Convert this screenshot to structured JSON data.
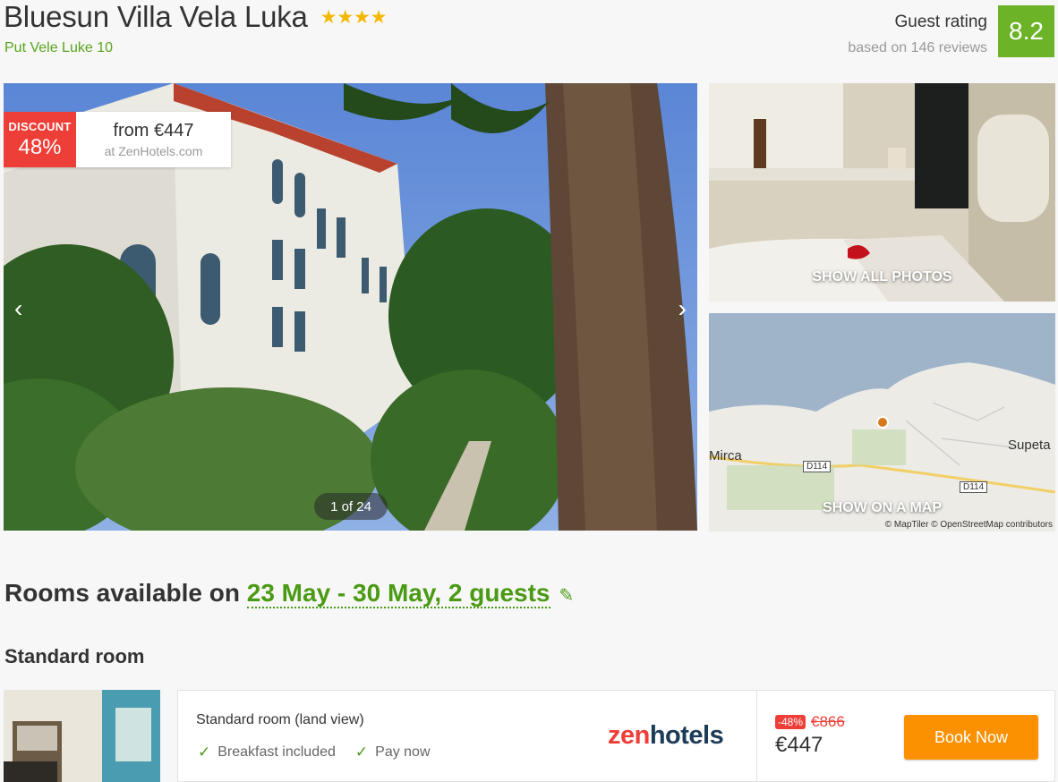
{
  "hotel": {
    "name": "Bluesun Villa Vela Luka",
    "stars": "★★★★",
    "address": "Put Vele Luke 10"
  },
  "rating": {
    "label": "Guest rating",
    "reviews": "based on 146 reviews",
    "score": "8.2"
  },
  "gallery": {
    "discount_label": "DISCOUNT",
    "discount_value": "48%",
    "from_price": "from €447",
    "source": "at ZenHotels.com",
    "counter": "1 of 24",
    "prev_icon": "‹",
    "next_icon": "›",
    "show_photos": "SHOW ALL PHOTOS"
  },
  "map": {
    "show_map": "SHOW ON A MAP",
    "credit": "© MapTiler © OpenStreetMap contributors",
    "city_left": "Mirca",
    "city_right": "Supeta",
    "road_1": "D114",
    "road_2": "D114"
  },
  "rooms": {
    "prefix": "Rooms available on ",
    "dates": "23 May - 30 May, 2 guests",
    "edit_icon": "✎",
    "room_type": "Standard room"
  },
  "offer": {
    "room_name": "Standard room (land view)",
    "amenity_1": "Breakfast included",
    "amenity_2": "Pay now",
    "check_icon": "✓",
    "provider_zen": "zen",
    "provider_hotels": "hotels",
    "discount_pct": "-48%",
    "old_price": "€866",
    "new_price": "€447",
    "book_label": "Book Now"
  },
  "colors": {
    "brand_green": "#6cb327",
    "link_green": "#4a9a14",
    "discount_red": "#ee3e38",
    "book_orange": "#fb9100"
  }
}
